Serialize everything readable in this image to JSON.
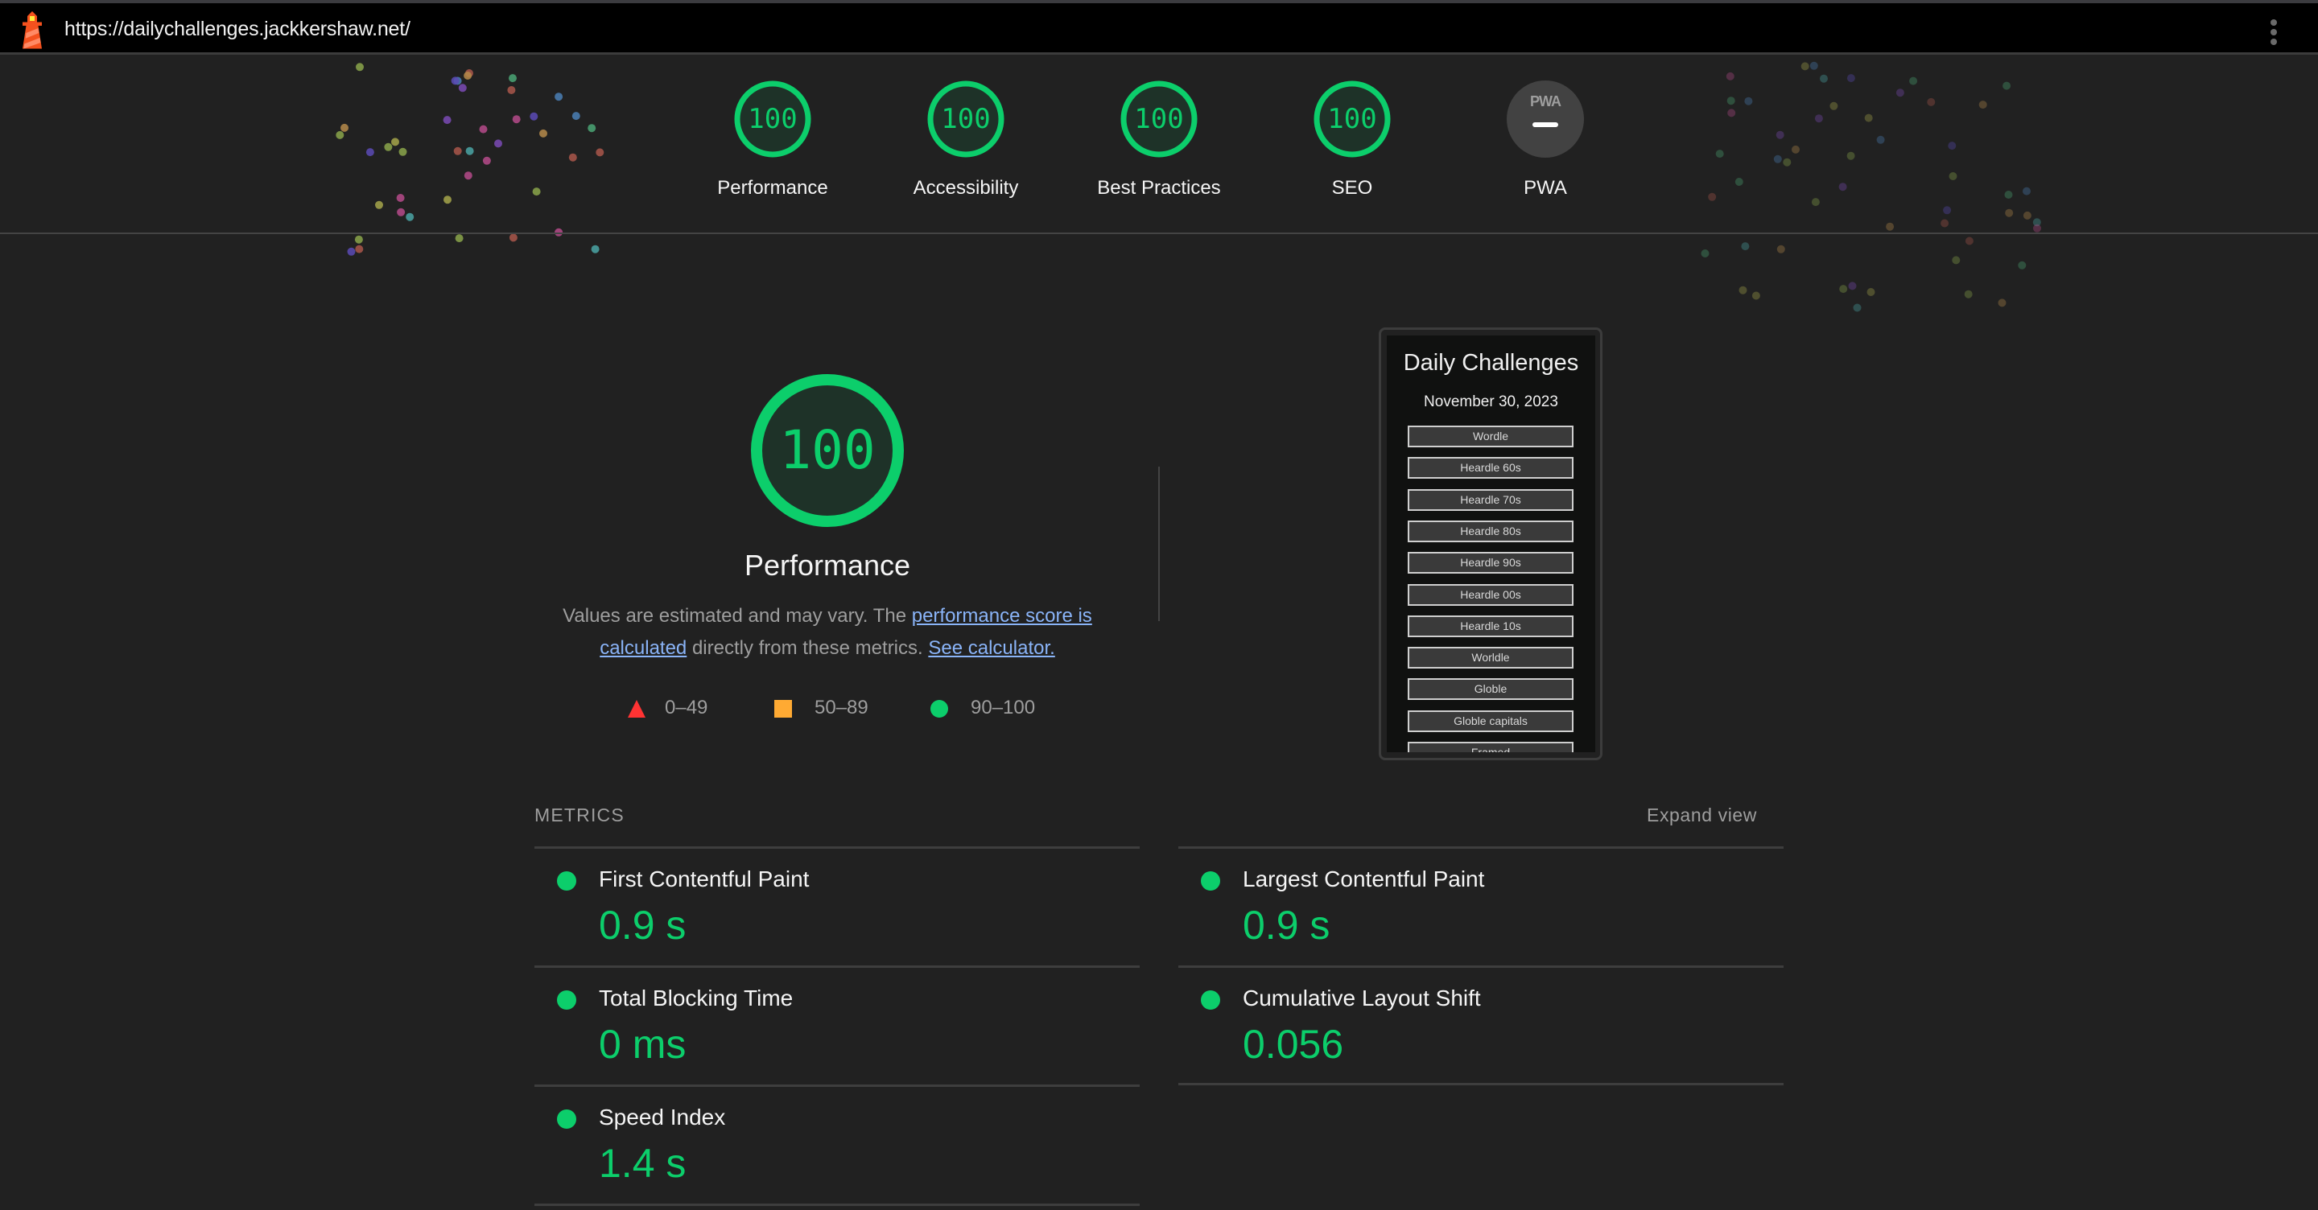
{
  "topbar": {
    "url": "https://dailychallenges.jackkershaw.net/",
    "logo_icon": "lighthouse-icon",
    "menu_icon": "kebab-menu-icon"
  },
  "colors": {
    "pass": "#0cce6b",
    "average": "#ffaa33",
    "fail": "#ff3333",
    "link": "#8ab4f8",
    "background": "#212121"
  },
  "categories": [
    {
      "label": "Performance",
      "score": "100"
    },
    {
      "label": "Accessibility",
      "score": "100"
    },
    {
      "label": "Best Practices",
      "score": "100"
    },
    {
      "label": "SEO",
      "score": "100"
    },
    {
      "label": "PWA",
      "score": null,
      "badge_text": "PWA"
    }
  ],
  "performance": {
    "score": "100",
    "score_fraction": 1.0,
    "title": "Performance",
    "description_prefix": "Values are estimated and may vary. The ",
    "link_score": "performance score is calculated",
    "description_middle": " directly from these metrics. ",
    "link_calculator": "See calculator."
  },
  "legend": [
    {
      "shape": "triangle",
      "range": "0–49"
    },
    {
      "shape": "square",
      "range": "50–89"
    },
    {
      "shape": "circle",
      "range": "90–100"
    }
  ],
  "thumbnail": {
    "title": "Daily Challenges",
    "date": "November 30, 2023",
    "buttons": [
      "Wordle",
      "Heardle 60s",
      "Heardle 70s",
      "Heardle 80s",
      "Heardle 90s",
      "Heardle 00s",
      "Heardle 10s",
      "Worldle",
      "Globle",
      "Globle capitals",
      "Framed"
    ]
  },
  "metrics": {
    "heading": "METRICS",
    "expand_label": "Expand view",
    "items": [
      {
        "label": "First Contentful Paint",
        "value": "0.9 s"
      },
      {
        "label": "Largest Contentful Paint",
        "value": "0.9 s"
      },
      {
        "label": "Total Blocking Time",
        "value": "0 ms"
      },
      {
        "label": "Cumulative Layout Shift",
        "value": "0.056"
      },
      {
        "label": "Speed Index",
        "value": "1.4 s"
      }
    ]
  }
}
